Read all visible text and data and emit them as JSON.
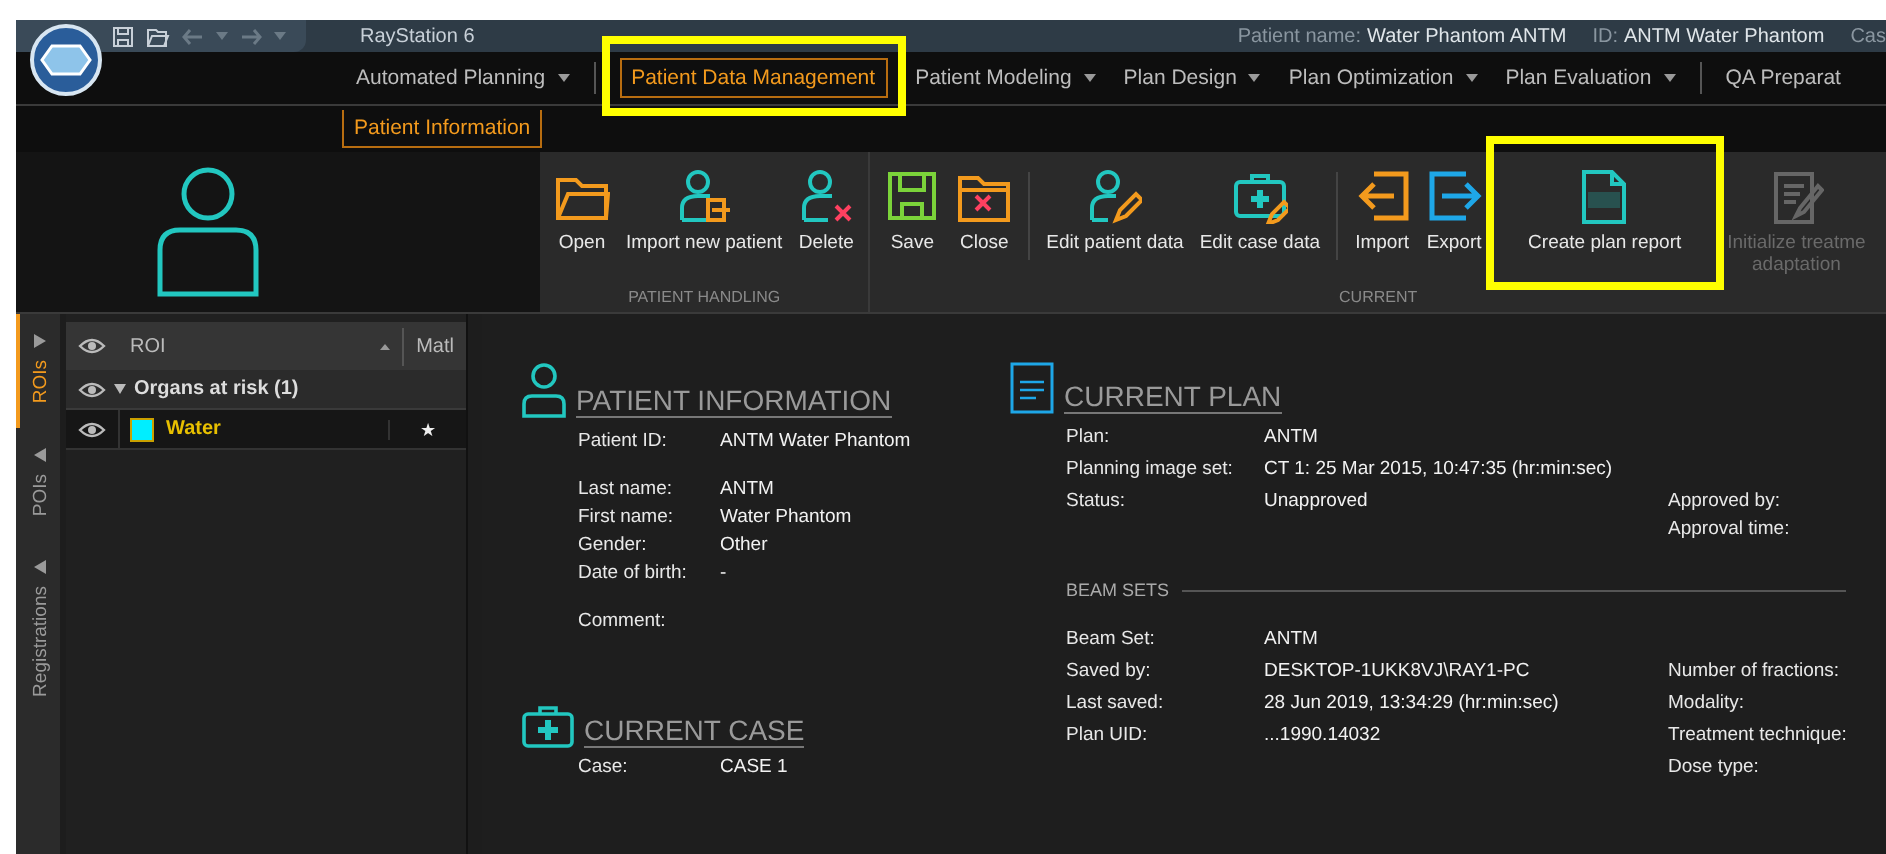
{
  "title_bar": {
    "app_title": "RayStation 6",
    "patient_info": [
      {
        "label": "Patient name:",
        "value": "Water Phantom ANTM"
      },
      {
        "label": "ID:",
        "value": "ANTM Water Phantom"
      },
      {
        "label": "Cas"
      }
    ]
  },
  "menu_tabs": [
    {
      "kind": "tab",
      "label": "Automated Planning",
      "dropdown": true,
      "selected": false,
      "highlighted": false
    },
    {
      "kind": "separator"
    },
    {
      "kind": "tab",
      "label": "Patient Data Management",
      "dropdown": false,
      "selected": true,
      "highlighted": true
    },
    {
      "kind": "tab",
      "label": "Patient Modeling",
      "dropdown": true,
      "selected": false,
      "highlighted": false
    },
    {
      "kind": "tab",
      "label": "Plan Design",
      "dropdown": true,
      "selected": false,
      "highlighted": false
    },
    {
      "kind": "tab",
      "label": "Plan Optimization",
      "dropdown": true,
      "selected": false,
      "highlighted": false
    },
    {
      "kind": "tab",
      "label": "Plan Evaluation",
      "dropdown": true,
      "selected": false,
      "highlighted": false
    },
    {
      "kind": "separator"
    },
    {
      "kind": "tab",
      "label": "QA Preparat",
      "dropdown": false,
      "selected": false,
      "highlighted": false
    }
  ],
  "sub_tabs": [
    {
      "label": "Patient Information",
      "selected": true
    }
  ],
  "ribbon_groups": [
    {
      "label": "PATIENT HANDLING",
      "buttons": [
        {
          "kind": "button",
          "label": "Open",
          "disabled": false,
          "highlighted": false
        },
        {
          "kind": "button",
          "label": "Import new patient",
          "disabled": false,
          "highlighted": false
        },
        {
          "kind": "button",
          "label": "Delete",
          "disabled": false,
          "highlighted": false
        }
      ]
    },
    {
      "label": "CURRENT",
      "buttons": [
        {
          "kind": "button",
          "label": "Save",
          "disabled": false,
          "highlighted": false
        },
        {
          "kind": "button",
          "label": "Close",
          "disabled": false,
          "highlighted": false
        },
        {
          "kind": "separator"
        },
        {
          "kind": "button",
          "label": "Edit patient data",
          "disabled": false,
          "highlighted": false
        },
        {
          "kind": "button",
          "label": "Edit case data",
          "disabled": false,
          "highlighted": false
        },
        {
          "kind": "separator"
        },
        {
          "kind": "button",
          "label": "Import",
          "disabled": false,
          "highlighted": false
        },
        {
          "kind": "button",
          "label": "Export",
          "disabled": false,
          "highlighted": false
        },
        {
          "kind": "button",
          "label": "Create plan report",
          "disabled": false,
          "highlighted": true
        },
        {
          "kind": "button",
          "label": "Initialize treatme\nadaptation",
          "disabled": true,
          "highlighted": false
        }
      ]
    }
  ],
  "roi_panel": {
    "vertical_tabs": [
      {
        "label": "ROIs",
        "selected": true
      },
      {
        "label": "POIs",
        "selected": false
      },
      {
        "label": "Registrations",
        "selected": false
      }
    ],
    "columns": [
      "ROI",
      "Matl"
    ],
    "groups": [
      {
        "label": "Organs at risk (1)",
        "expanded": true,
        "children": [
          {
            "name": "Water",
            "color": "#00eeff",
            "selected": true,
            "mark": "★"
          }
        ]
      }
    ]
  },
  "patient_information": {
    "title": "PATIENT INFORMATION",
    "field_groups": [
      [
        {
          "label": "Patient ID:",
          "value": "ANTM Water Phantom"
        }
      ],
      [
        {
          "label": "Last name:",
          "value": "ANTM"
        },
        {
          "label": "First name:",
          "value": "Water Phantom"
        },
        {
          "label": "Gender:",
          "value": "Other"
        },
        {
          "label": "Date of birth:",
          "value": "-"
        }
      ],
      [
        {
          "label": "Comment:"
        }
      ]
    ]
  },
  "current_case": {
    "title": "CURRENT CASE",
    "fields": [
      {
        "label": "Case:",
        "value": "CASE 1"
      }
    ]
  },
  "current_plan": {
    "title": "CURRENT PLAN",
    "fields": [
      {
        "label": "Plan:",
        "value": "ANTM"
      },
      {
        "label": "Planning image set:",
        "value": "CT 1: 25 Mar 2015, 10:47:35 (hr:min:sec)"
      },
      {
        "label": "Status:",
        "value": "Unapproved",
        "side": [
          "Approved by:",
          "Approval time:"
        ]
      }
    ],
    "beam_sets": {
      "title": "BEAM SETS",
      "rows": [
        {
          "label": "Beam Set:",
          "value": "ANTM"
        },
        {
          "label": "Saved by:",
          "value": "DESKTOP-1UKK8VJ\\RAY1-PC",
          "side": [
            "Number of fractions:"
          ]
        },
        {
          "label": "Last saved:",
          "value": "28 Jun 2019, 13:34:29 (hr:min:sec)",
          "side": [
            "Modality:"
          ]
        },
        {
          "label": "Plan UID:",
          "value": "...1990.14032",
          "side": [
            "Treatment technique:"
          ]
        },
        {
          "side": [
            "Dose type:"
          ]
        }
      ]
    }
  }
}
